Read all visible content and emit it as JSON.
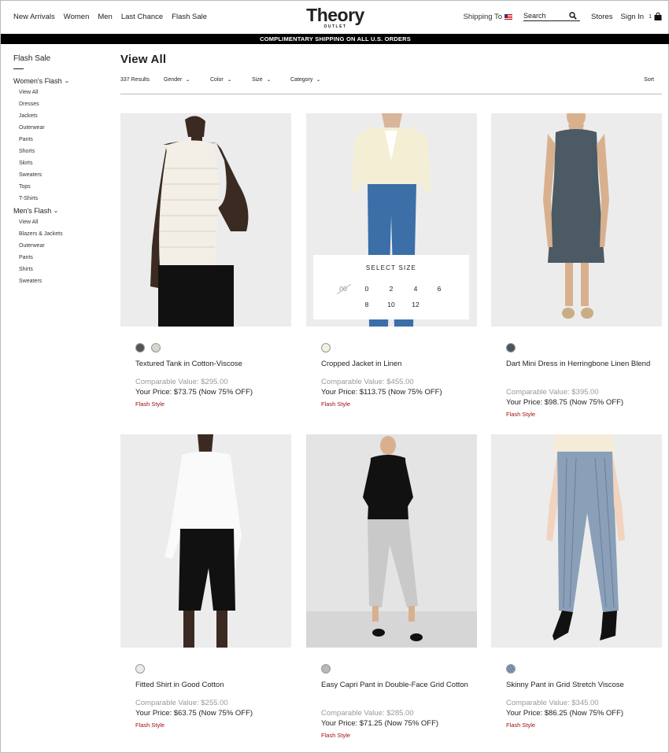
{
  "header": {
    "nav": [
      "New Arrivals",
      "Women",
      "Men",
      "Last Chance",
      "Flash Sale"
    ],
    "logo_main": "Theory",
    "logo_sub": "OUTLET",
    "shipping_label": "Shipping To",
    "search_placeholder": "Search",
    "stores": "Stores",
    "signin": "Sign In",
    "bag_count": "1"
  },
  "promo": "COMPLIMENTARY SHIPPING ON ALL U.S. ORDERS",
  "sidebar": {
    "title": "Flash Sale",
    "womens": {
      "label": "Women's Flash",
      "items": [
        "View All",
        "Dresses",
        "Jackets",
        "Outerwear",
        "Pants",
        "Shorts",
        "Skirts",
        "Sweaters",
        "Tops",
        "T-Shirts"
      ]
    },
    "mens": {
      "label": "Men's Flash",
      "items": [
        "View All",
        "Blazers & Jackets",
        "Outerwear",
        "Pants",
        "Shirts",
        "Sweaters"
      ]
    }
  },
  "main": {
    "title": "View All",
    "results": "337 Results",
    "filters": [
      "Gender",
      "Color",
      "Size",
      "Category"
    ],
    "sort": "Sort"
  },
  "size_selector": {
    "title": "SELECT SIZE",
    "row1": [
      "00",
      "0",
      "2",
      "4",
      "6"
    ],
    "row2": [
      "8",
      "10",
      "12"
    ],
    "unavailable": [
      "00"
    ]
  },
  "products": [
    {
      "name": "Textured Tank in Cotton-Viscose",
      "comparable": "Comparable Value: $295.00",
      "price": "Your Price: $73.75 (Now 75% OFF)",
      "flash": "Flash Style",
      "swatches": [
        "#555555",
        "#e8e4da"
      ]
    },
    {
      "name": "Cropped Jacket in Linen",
      "comparable": "Comparable Value: $455.00",
      "price": "Your Price: $113.75 (Now 75% OFF)",
      "flash": "Flash Style",
      "swatches": [
        "#f3f0df"
      ]
    },
    {
      "name": "Dart Mini Dress in Herringbone Linen Blend",
      "comparable": "Comparable Value: $395.00",
      "price": "Your Price: $98.75 (Now 75% OFF)",
      "flash": "Flash Style",
      "swatches": [
        "#4a5560"
      ]
    },
    {
      "name": "Fitted Shirt in Good Cotton",
      "comparable": "Comparable Value: $255.00",
      "price": "Your Price: $63.75 (Now 75% OFF)",
      "flash": "Flash Style",
      "swatches": [
        "#e8ecf0"
      ]
    },
    {
      "name": "Easy Capri Pant in Double-Face Grid Cotton",
      "comparable": "Comparable Value: $285.00",
      "price": "Your Price: $71.25 (Now 75% OFF)",
      "flash": "Flash Style",
      "swatches": [
        "#b8b8b8"
      ]
    },
    {
      "name": "Skinny Pant in Grid Stretch Viscose",
      "comparable": "Comparable Value: $345.00",
      "price": "Your Price: $86.25 (Now 75% OFF)",
      "flash": "Flash Style",
      "swatches": [
        "#8aa0b8"
      ]
    }
  ]
}
